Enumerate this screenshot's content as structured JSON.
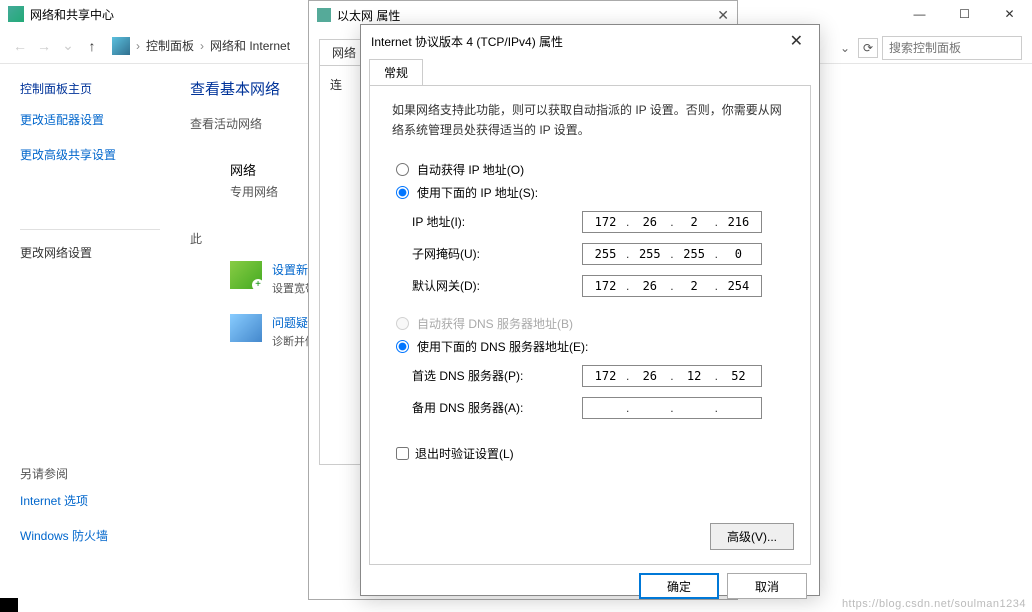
{
  "bg": {
    "title": "网络和共享中心",
    "breadcrumb": {
      "root": "控制面板",
      "item": "网络和 Internet"
    },
    "search_placeholder": "搜索控制面板",
    "sidebar": {
      "home": "控制面板主页",
      "adapter": "更改适配器设置",
      "sharing": "更改高级共享设置",
      "change_net": "更改网络设置",
      "see_also": "另请参阅",
      "inet_options": "Internet 选项",
      "firewall": "Windows 防火墙"
    },
    "main": {
      "heading": "查看基本网络",
      "active_nets": "查看活动网络",
      "net_name": "网络",
      "net_type": "专用网络",
      "this_label": "此",
      "conn_label": "连",
      "task_setup_title": "设置新的",
      "task_setup_sub": "设置宽带",
      "task_trouble_title": "问题疑难",
      "task_trouble_sub": "诊断并修"
    }
  },
  "eth": {
    "title": "以太网 属性",
    "tab": "网络"
  },
  "ipv4": {
    "title": "Internet 协议版本 4 (TCP/IPv4) 属性",
    "tab": "常规",
    "desc": "如果网络支持此功能，则可以获取自动指派的 IP 设置。否则，你需要从网络系统管理员处获得适当的 IP 设置。",
    "auto_ip": "自动获得 IP 地址(O)",
    "manual_ip": "使用下面的 IP 地址(S):",
    "ip_label": "IP 地址(I):",
    "mask_label": "子网掩码(U):",
    "gw_label": "默认网关(D):",
    "auto_dns": "自动获得 DNS 服务器地址(B)",
    "manual_dns": "使用下面的 DNS 服务器地址(E):",
    "dns1_label": "首选 DNS 服务器(P):",
    "dns2_label": "备用 DNS 服务器(A):",
    "validate": "退出时验证设置(L)",
    "advanced": "高级(V)...",
    "ok": "确定",
    "cancel": "取消",
    "ip": [
      "172",
      "26",
      "2",
      "216"
    ],
    "mask": [
      "255",
      "255",
      "255",
      "0"
    ],
    "gw": [
      "172",
      "26",
      "2",
      "254"
    ],
    "dns1": [
      "172",
      "26",
      "12",
      "52"
    ],
    "dns2": [
      "",
      "",
      "",
      ""
    ]
  },
  "watermark": "https://blog.csdn.net/soulman1234"
}
